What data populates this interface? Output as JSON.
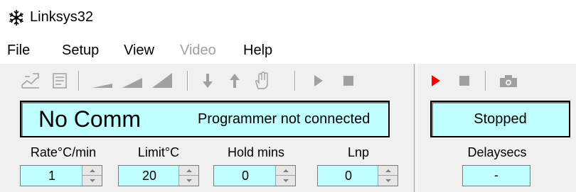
{
  "window": {
    "title": "Linksys32",
    "icon": "snowflake-icon"
  },
  "menu": {
    "file": "File",
    "setup": "Setup",
    "view": "View",
    "video": "Video",
    "help": "Help"
  },
  "toolbar_left": [
    "profile-edit-icon",
    "profile-list-icon",
    "ramp-low-icon",
    "ramp-mid-icon",
    "ramp-high-icon",
    "arrow-down-icon",
    "arrow-up-icon",
    "hand-hold-icon",
    "play-icon",
    "stop-icon"
  ],
  "toolbar_right": [
    "play-icon",
    "stop-icon",
    "camera-icon"
  ],
  "status": {
    "comm": "No Comm",
    "message": "Programmer not connected",
    "run_state": "Stopped"
  },
  "fields": {
    "rate": {
      "label": "Rate°C/min",
      "value": "1"
    },
    "limit": {
      "label": "Limit°C",
      "value": "20"
    },
    "hold": {
      "label": "Hold mins",
      "value": "0"
    },
    "lnp": {
      "label": "Lnp",
      "value": "0"
    },
    "delay": {
      "label": "Delaysecs",
      "value": "-"
    }
  },
  "colors": {
    "lcd_bg": "#c0ffff",
    "play_active": "#ff0000",
    "disabled_gray": "#a0a0a0"
  }
}
